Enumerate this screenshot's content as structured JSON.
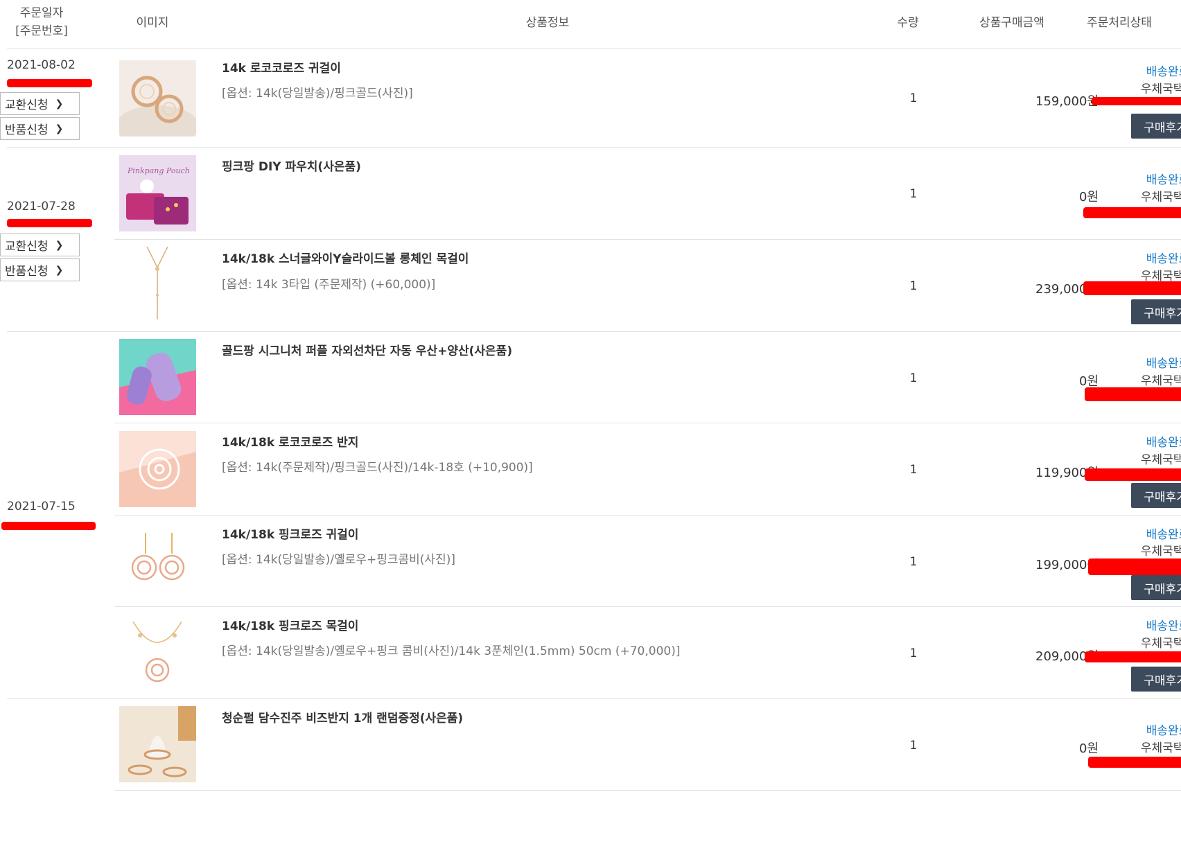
{
  "header": {
    "date_line1": "주문일자",
    "date_line2": "[주문번호]",
    "image": "이미지",
    "info": "상품정보",
    "qty": "수량",
    "amount": "상품구매금액",
    "status": "주문처리상태"
  },
  "buttons": {
    "exchange": "교환신청",
    "return": "반품신청",
    "review": "구매후기"
  },
  "groups": [
    {
      "date": "2021-08-02"
    },
    {
      "date": "2021-07-28"
    },
    {
      "date": "2021-07-15"
    }
  ],
  "items": [
    {
      "name": "14k 로코코로즈 귀걸이",
      "option": "[옵션: 14k(당일발송)/핑크골드(사진)]",
      "qty": "1",
      "amount": "159,000원",
      "status": "배송완료",
      "carrier": "우체국택배"
    },
    {
      "name": "핑크팡 DIY 파우치(사은품)",
      "option": "",
      "qty": "1",
      "amount": "0원",
      "status": "배송완료",
      "carrier": "우체국택배",
      "pouch_script": "Pinkpang Pouch"
    },
    {
      "name": "14k/18k 스너글와이Y슬라이드볼 롱체인 목걸이",
      "option": "[옵션: 14k 3타입 (주문제작) (+60,000)]",
      "qty": "1",
      "amount": "239,000원",
      "status": "배송완료",
      "carrier": "우체국택배"
    },
    {
      "name": "골드팡 시그니처 퍼플 자외선차단 자동 우산+양산(사은품)",
      "option": "",
      "qty": "1",
      "amount": "0원",
      "status": "배송완료",
      "carrier": "우체국택배"
    },
    {
      "name": "14k/18k 로코코로즈 반지",
      "option": "[옵션: 14k(주문제작)/핑크골드(사진)/14k-18호 (+10,900)]",
      "qty": "1",
      "amount": "119,900원",
      "status": "배송완료",
      "carrier": "우체국택배"
    },
    {
      "name": "14k/18k 핑크로즈 귀걸이",
      "option": "[옵션: 14k(당일발송)/옐로우+핑크콤비(사진)]",
      "qty": "1",
      "amount": "199,000원",
      "status": "배송완료",
      "carrier": "우체국택배"
    },
    {
      "name": "14k/18k 핑크로즈 목걸이",
      "option": "[옵션: 14k(당일발송)/옐로우+핑크 콤비(사진)/14k 3푼체인(1.5mm) 50cm (+70,000)]",
      "qty": "1",
      "amount": "209,000원",
      "status": "배송완료",
      "carrier": "우체국택배"
    },
    {
      "name": "청순펄 담수진주 비즈반지 1개 랜덤증정(사은품)",
      "option": "",
      "qty": "1",
      "amount": "0원",
      "status": "배송완료",
      "carrier": "우체국택배"
    }
  ],
  "colors": {
    "status_link": "#1a7bc7",
    "review_button": "#3d4a5c",
    "redaction": "#ff0000"
  }
}
